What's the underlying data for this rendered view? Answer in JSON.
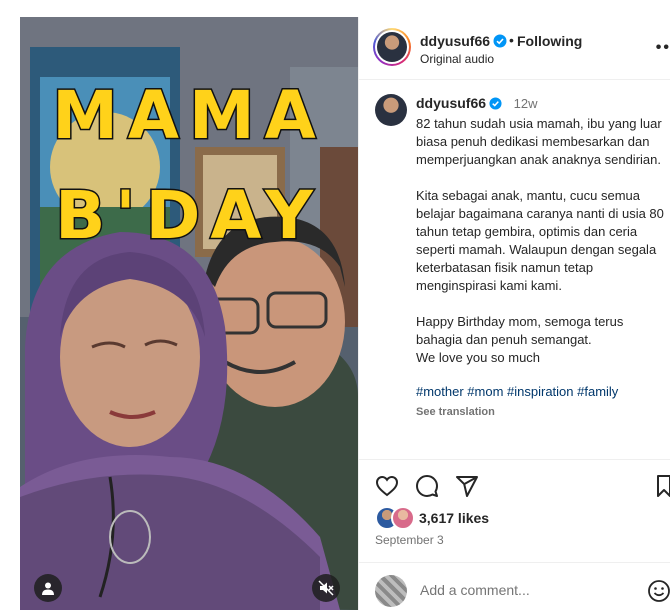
{
  "media": {
    "overlay_line1": "MAMA",
    "overlay_line2": "B'DAY"
  },
  "header": {
    "username": "ddyusuf66",
    "separator": "•",
    "follow_label": "Following",
    "audio_label": "Original audio",
    "more_label": "••"
  },
  "caption": {
    "username": "ddyusuf66",
    "time": "12w",
    "body": "82 tahun sudah usia mamah, ibu yang luar biasa penuh dedikasi membesarkan dan memperjuangkan anak anaknya sendirian.\n\nKita sebagai anak, mantu, cucu semua belajar bagaimana caranya nanti di usia 80 tahun tetap gembira, optimis dan ceria seperti mamah. Walaupun dengan segala keterbatasan fisik namun tetap menginspirasi kami kami.\n\nHappy Birthday mom, semoga terus bahagia dan penuh semangat.\nWe love you so much",
    "hashtags": "#mother #mom #inspiration #family",
    "see_translation": "See translation"
  },
  "actions": {
    "likes": "3,617 likes",
    "date": "September 3",
    "comment_placeholder": "Add a comment..."
  },
  "colors": {
    "overlay_text": "#ffd21a",
    "verified_badge": "#0095f6",
    "link": "#00376b"
  }
}
